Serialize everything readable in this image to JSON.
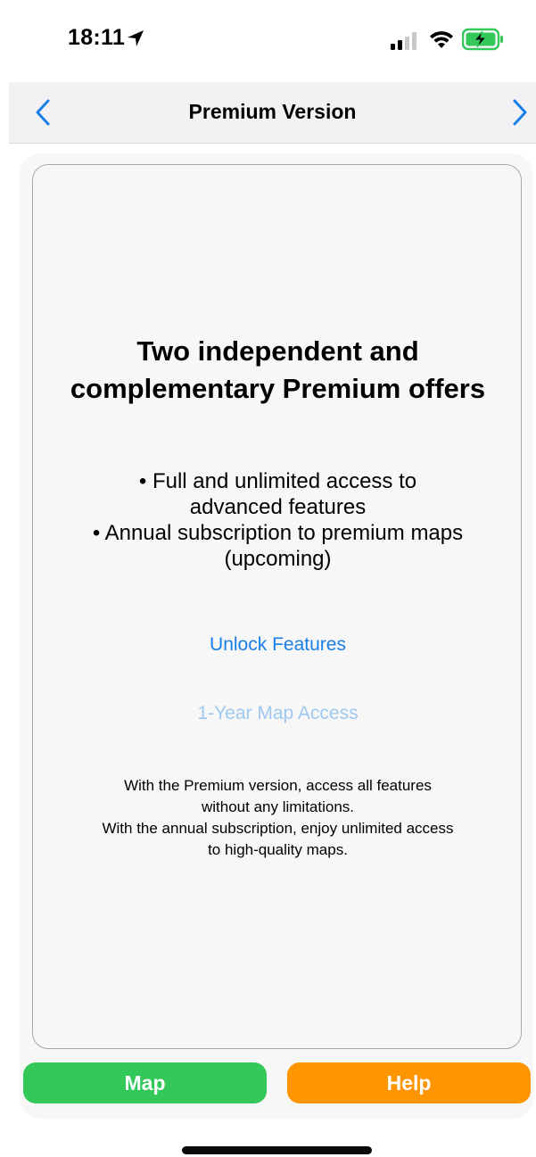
{
  "status_bar": {
    "time": "18:11",
    "icons": [
      "location-arrow-icon",
      "cellular-signal-icon",
      "wifi-icon",
      "battery-charging-icon"
    ]
  },
  "nav": {
    "title": "Premium Version",
    "back_icon": "chevron-left-icon",
    "forward_icon": "chevron-right-icon"
  },
  "card": {
    "title": "Two independent and complementary Premium offers",
    "bullets": [
      "• Full and unlimited access to",
      "advanced features",
      "• Annual subscription to premium maps",
      "(upcoming)"
    ],
    "unlock_features_label": "Unlock Features",
    "map_access_label": "1-Year Map Access",
    "description": [
      "With the Premium version, access all features",
      "without any limitations.",
      "With the annual subscription, enjoy unlimited access",
      "to high-quality maps."
    ]
  },
  "buttons": {
    "map_label": "Map",
    "help_label": "Help"
  },
  "colors": {
    "accent_blue": "#1a7ee8",
    "disabled_blue": "#9fc8f0",
    "map_green": "#34c759",
    "help_orange": "#ff9500",
    "battery_green": "#34c759"
  }
}
